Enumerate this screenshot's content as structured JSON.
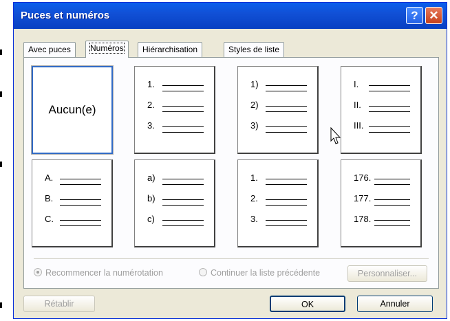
{
  "window": {
    "title": "Puces et numéros",
    "help_label": "?",
    "close_label": "✕"
  },
  "tabs": [
    {
      "label": "Avec puces",
      "active": false
    },
    {
      "label": "Numéros",
      "active": true
    },
    {
      "label": "Hiérarchisation",
      "active": false
    },
    {
      "label": "Styles de liste",
      "active": false
    }
  ],
  "gallery": {
    "none_label": "Aucun(e)",
    "styles": [
      {
        "id": "none",
        "selected": true
      },
      {
        "id": "dot-number",
        "markers": [
          "1.",
          "2.",
          "3."
        ]
      },
      {
        "id": "paren-number",
        "markers": [
          "1)",
          "2)",
          "3)"
        ]
      },
      {
        "id": "roman",
        "markers": [
          "I.",
          "II.",
          "III."
        ]
      },
      {
        "id": "upper-alpha",
        "markers": [
          "A.",
          "B.",
          "C."
        ]
      },
      {
        "id": "lower-alpha",
        "markers": [
          "a)",
          "b)",
          "c)"
        ]
      },
      {
        "id": "dot-number-2",
        "markers": [
          "1.",
          "2.",
          "3."
        ]
      },
      {
        "id": "continued",
        "markers": [
          "176.",
          "177.",
          "178."
        ]
      }
    ]
  },
  "options": {
    "restart_label": "Recommencer la numérotation",
    "restart_checked": true,
    "continue_label": "Continuer la liste précédente",
    "continue_checked": false,
    "customize_label": "Personnaliser..."
  },
  "buttons": {
    "reset_label": "Rétablir",
    "ok_label": "OK",
    "cancel_label": "Annuler"
  },
  "colors": {
    "title_bar": "#0a5fec",
    "selection": "#316ac5",
    "dialog_bg": "#ece9d8"
  }
}
